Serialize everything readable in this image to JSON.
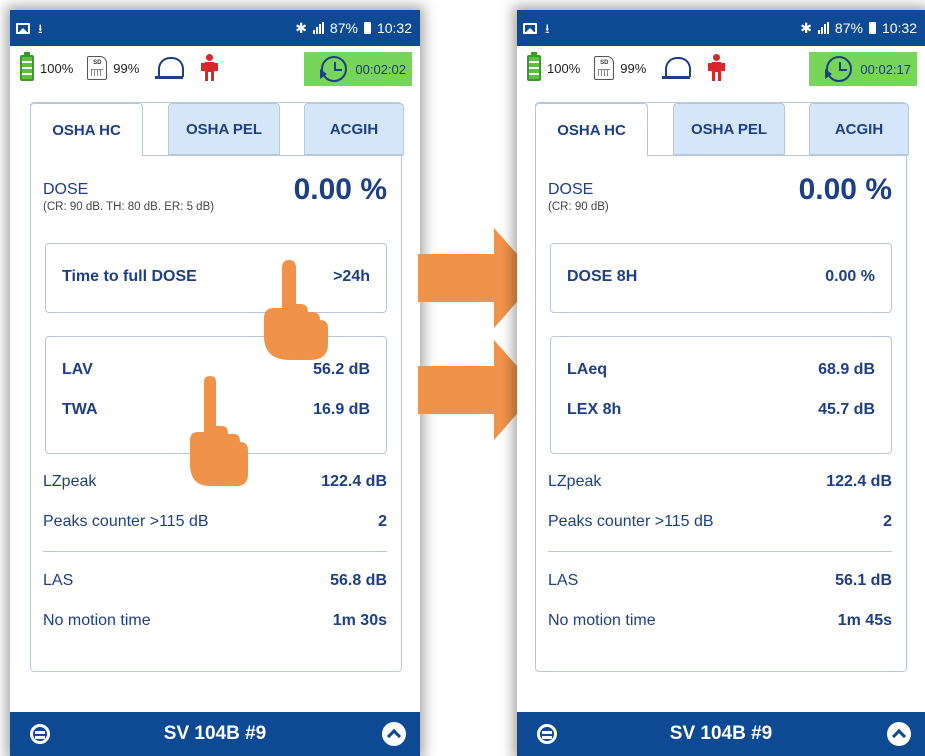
{
  "colors": {
    "primary_blue": "#0d4a93",
    "text_blue": "#1c3f85",
    "timer_green": "#77d65a",
    "arrow_orange": "#f0934a",
    "person_red": "#d8262b"
  },
  "left": {
    "status": {
      "signal": "87%",
      "time": "10:32"
    },
    "info": {
      "battery": "100%",
      "sd": "99%",
      "sd_label": "SD",
      "timer": "00:02:02"
    },
    "tabs": [
      "OSHA HC",
      "OSHA PEL",
      "ACGIH"
    ],
    "dose": {
      "label": "DOSE",
      "sub": "(CR: 90 dB. TH: 80 dB. ER: 5 dB)",
      "value": "0.00 %"
    },
    "box1": {
      "label": "Time to full DOSE",
      "value": ">24h"
    },
    "box2": [
      {
        "label": "LAV",
        "value": "56.2 dB"
      },
      {
        "label": "TWA",
        "value": "16.9 dB"
      }
    ],
    "rows": [
      {
        "label": "LZpeak",
        "value": "122.4 dB"
      },
      {
        "label": "Peaks counter >115 dB",
        "value": "2"
      },
      {
        "label": "LAS",
        "value": "56.8 dB"
      },
      {
        "label": "No motion time",
        "value": "1m 30s"
      }
    ],
    "footer": "SV 104B #9"
  },
  "right": {
    "status": {
      "signal": "87%",
      "time": "10:32"
    },
    "info": {
      "battery": "100%",
      "sd": "99%",
      "sd_label": "SD",
      "timer": "00:02:17"
    },
    "tabs": [
      "OSHA HC",
      "OSHA PEL",
      "ACGIH"
    ],
    "dose": {
      "label": "DOSE",
      "sub": "(CR: 90 dB)",
      "value": "0.00 %"
    },
    "box1": {
      "label": "DOSE 8H",
      "value": "0.00 %"
    },
    "box2": [
      {
        "label": "LAeq",
        "value": "68.9 dB"
      },
      {
        "label": "LEX 8h",
        "value": "45.7 dB"
      }
    ],
    "rows": [
      {
        "label": "LZpeak",
        "value": "122.4 dB"
      },
      {
        "label": "Peaks counter >115 dB",
        "value": "2"
      },
      {
        "label": "LAS",
        "value": "56.1 dB"
      },
      {
        "label": "No motion time",
        "value": "1m 45s"
      }
    ],
    "footer": "SV 104B #9"
  },
  "icons": [
    "image-icon",
    "download-icon",
    "bluetooth-icon",
    "signal-icon",
    "battery-icon",
    "sd-card-icon",
    "alarm-icon",
    "person-icon",
    "clock-icon",
    "logo-icon",
    "chevron-up-icon",
    "hand-pointer-icon",
    "arrow-right-icon"
  ]
}
